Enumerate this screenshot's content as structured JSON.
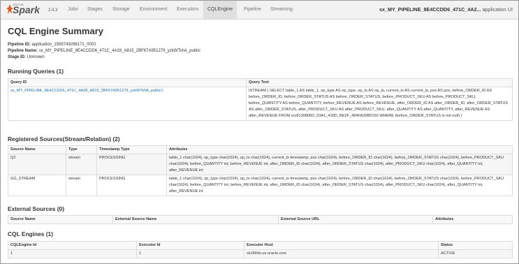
{
  "nav": {
    "brand_small": "APACHE",
    "brand": "Spark",
    "version": "2.4.3",
    "tabs": [
      "Jobs",
      "Stages",
      "Storage",
      "Environment",
      "Executors",
      "CQLEngine",
      "Pipeline",
      "Streaming"
    ],
    "active_tab": "CQLEngine",
    "app_name": "sx_MY_PIPELINE_8E4CCDD6_471C_4A2...",
    "app_suffix": "application UI"
  },
  "page": {
    "title": "CQL Engine Summary",
    "pipeline_id_label": "Pipeline ID:",
    "pipeline_id": "application_1558749296171_0002",
    "pipeline_name_label": "Pipeline Name:",
    "pipeline_name": "sx_MY_PIPELINE_8E4CCDD6_471C_4A28_A815_2BF67A951279_yzkWTshA_public",
    "stage_id_label": "Stage ID:",
    "stage_id": "Unknown"
  },
  "running_queries": {
    "heading": "Running Queries (1)",
    "columns": [
      "Query ID",
      "Query Text"
    ],
    "rows": [
      {
        "id": "sx_MY_PIPELINE_8E4CCDD6_471C_4A28_A815_2BF67A951279_yzkWTshA_public1",
        "text": "ISTREAM ( SELECT table_1 AS table_1, op_type AS op_type, op_ts AS op_ts, current_ts AS current_ts, pos AS pos, before_ORDER_ID AS before_ORDER_ID, before_ORDER_STATUS AS before_ORDER_STATUS, before_PRODUCT_SKU AS before_PRODUCT_SKU, before_QUANTITY AS before_QUANTITY, before_REVENUE AS before_REVENUE, after_ORDER_ID AS after_ORDER_ID, after_ORDER_STATUS AS after_ORDER_STATUS, after_PRODUCT_SKU AS after_PRODUCT_SKU, after_QUANTITY AS after_QUANTITY, after_REVENUE AS after_REVENUE FROM src8130806D_53A1_439D_BE2F_494FA39B5150 WHERE (before_ORDER_STATUS is not null) )"
      }
    ]
  },
  "registered_sources": {
    "heading": "Registered Sources(Stream/Relation) (2)",
    "columns": [
      "Source Name",
      "Type",
      "Timestamp Type",
      "Attributes"
    ],
    "rows": [
      {
        "name": "Q2",
        "type": "stream",
        "ts_type": "PROCESSING",
        "attributes": "table_1 char(1024), op_type char(1024), op_ts char(1024), current_ts timestamp, pos char(1024), before_ORDER_ID char(1024), before_ORDER_STATUS char(1024), before_PRODUCT_SKU char(1024), before_QUANTITY int, before_REVENUE int, after_ORDER_ID char(1024), after_ORDER_STATUS char(1024), after_PRODUCT_SKU char(1024), after_QUANTITY int, after_REVENUE int"
      },
      {
        "name": "GG_STREAM",
        "type": "stream",
        "ts_type": "PROCESSING",
        "attributes": "table_1 char(1024), op_type char(1024), op_ts char(1024), current_ts timestamp, pos char(1024), before_ORDER_ID char(1024), before_ORDER_STATUS char(1024), before_PRODUCT_SKU char(1024), before_QUANTITY int, before_REVENUE int, after_ORDER_ID char(1024), after_ORDER_STATUS char(1024), after_PRODUCT_SKU char(1024), after_QUANTITY int, after_REVENUE int"
      }
    ]
  },
  "external_sources": {
    "heading": "External Sources (0)",
    "columns": [
      "Source Name",
      "External Source Name",
      "External Source URL",
      "Attributes"
    ]
  },
  "cql_engines": {
    "heading": "CQL Engines (1)",
    "columns": [
      "CQLEngine Id",
      "Executor Id",
      "Executor Host",
      "Status"
    ],
    "rows": [
      {
        "engine_id": "1",
        "executor_id": "1",
        "host": "slc06fdo.us.oracle.com",
        "status": "ACTIVE"
      }
    ]
  },
  "colors": {
    "link": "#1a6fb0",
    "navbar_bg": "#f2f2f2",
    "spark_orange": "#e25a1c"
  }
}
